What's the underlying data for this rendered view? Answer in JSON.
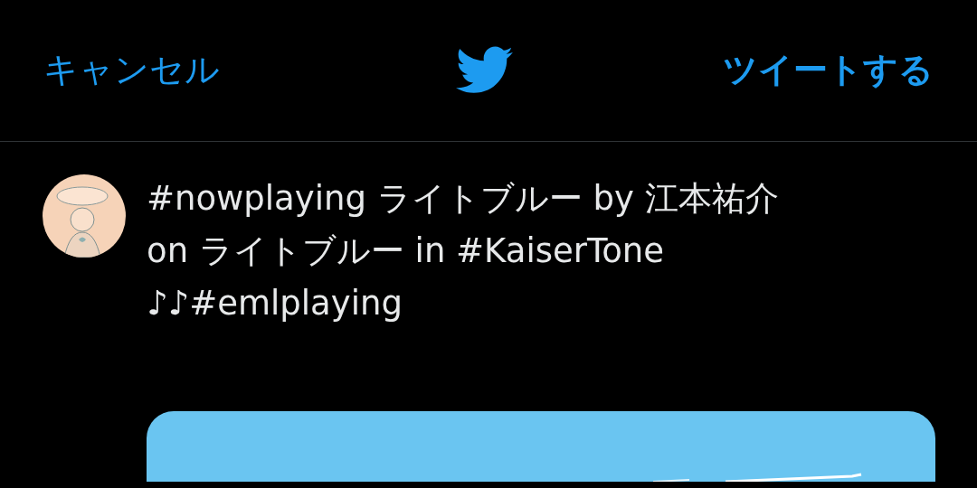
{
  "header": {
    "cancel": "キャンセル",
    "submit": "ツイートする"
  },
  "tweet": {
    "text": "#nowplaying ライトブルー by 江本祐介\non ライトブルー in #KaiserTone\n♪♪#emlplaying"
  }
}
